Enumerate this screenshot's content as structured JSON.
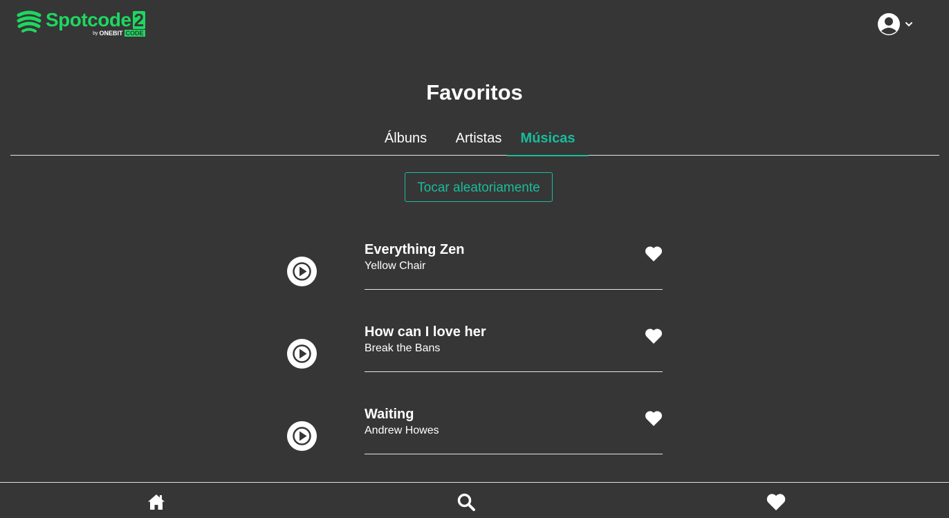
{
  "logo": {
    "word": "Spotcode",
    "number": "2",
    "by": "by",
    "brand_a": "ONEBIT",
    "brand_b": "CODE",
    "color": "#1ed760"
  },
  "header": {
    "user_icon": "user-circle-icon",
    "menu_icon": "chevron-down-icon"
  },
  "page": {
    "title": "Favoritos"
  },
  "tabs": [
    {
      "label": "Álbuns",
      "active": false
    },
    {
      "label": "Artistas",
      "active": false
    },
    {
      "label": "Músicas",
      "active": true
    }
  ],
  "shuffle": {
    "label": "Tocar aleatoriamente"
  },
  "songs": [
    {
      "title": "Everything Zen",
      "artist": "Yellow Chair",
      "favorite": true
    },
    {
      "title": "How can I love her",
      "artist": "Break the Bans",
      "favorite": true
    },
    {
      "title": "Waiting",
      "artist": "Andrew Howes",
      "favorite": true
    }
  ],
  "bottom_nav": [
    {
      "icon": "home-icon"
    },
    {
      "icon": "search-icon"
    },
    {
      "icon": "heart-icon"
    }
  ],
  "colors": {
    "background": "#363636",
    "accent": "#1abc9c",
    "brand": "#1ed760",
    "text": "#ffffff"
  }
}
